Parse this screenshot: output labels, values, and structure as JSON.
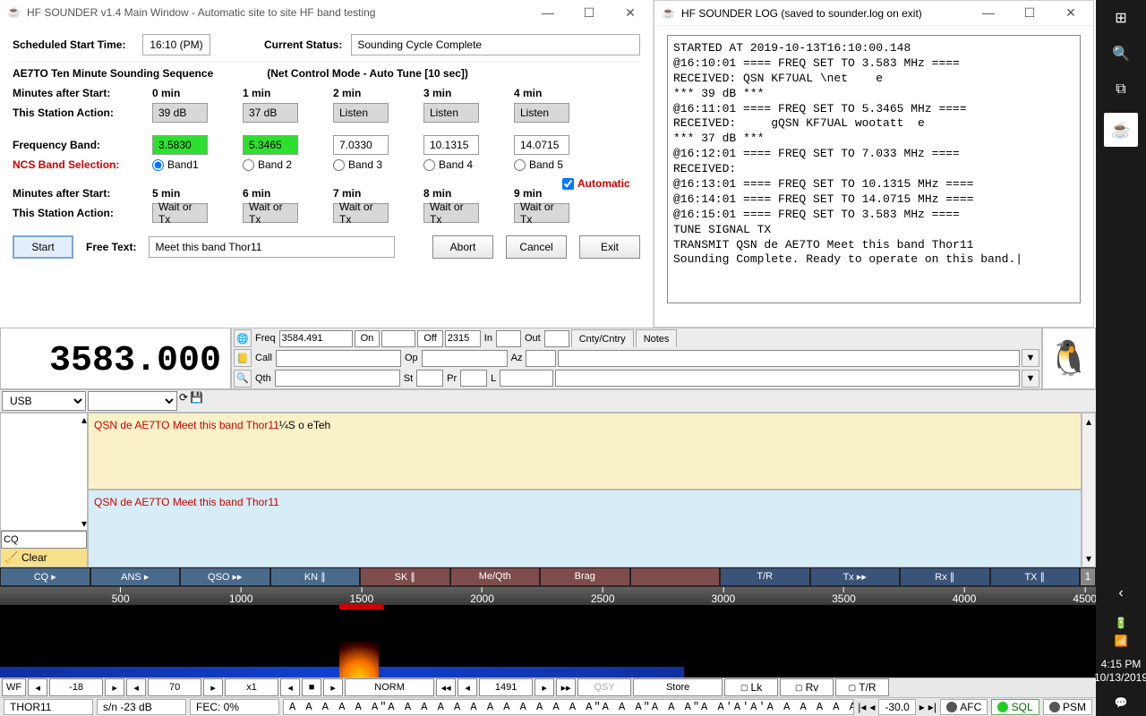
{
  "main": {
    "title": "HF SOUNDER v1.4 Main Window - Automatic site to site HF band testing",
    "scheduled_label": "Scheduled Start Time:",
    "scheduled_value": "16:10 (PM)",
    "status_label": "Current Status:",
    "status_value": "Sounding Cycle Complete",
    "sequence_title": "AE7TO  Ten Minute Sounding Sequence",
    "mode_title": "(Net Control Mode - Auto Tune [10 sec])",
    "lbl_minutes": "Minutes after Start:",
    "lbl_action": "This Station Action:",
    "lbl_freq": "Frequency Band:",
    "lbl_ncs": "NCS Band Selection:",
    "cols1": [
      {
        "min": "0 min",
        "sn": "39 dB",
        "freq": "3.5830",
        "band": "Band1",
        "green": true
      },
      {
        "min": "1 min",
        "sn": "37 dB",
        "freq": "5.3465",
        "band": "Band 2",
        "green": true
      },
      {
        "min": "2 min",
        "sn": "Listen",
        "freq": "7.0330",
        "band": "Band 3",
        "green": false
      },
      {
        "min": "3 min",
        "sn": "Listen",
        "freq": "10.1315",
        "band": "Band 4",
        "green": false
      },
      {
        "min": "4 min",
        "sn": "Listen",
        "freq": "14.0715",
        "band": "Band 5",
        "green": false
      }
    ],
    "auto_label": "Automatic",
    "cols2": [
      {
        "min": "5 min",
        "act": "Wait or Tx"
      },
      {
        "min": "6 min",
        "act": "Wait or Tx"
      },
      {
        "min": "7 min",
        "act": "Wait or Tx"
      },
      {
        "min": "8 min",
        "act": "Wait or Tx"
      },
      {
        "min": "9 min",
        "act": "Wait or Tx"
      }
    ],
    "btn_start": "Start",
    "btn_abort": "Abort",
    "btn_cancel": "Cancel",
    "btn_exit": "Exit",
    "lbl_free": "Free Text:",
    "free_value": "Meet this band Thor11"
  },
  "log": {
    "title": "HF SOUNDER LOG (saved to sounder.log on exit)",
    "text": "STARTED AT 2019-10-13T16:10:00.148\n@16:10:01 ==== FREQ SET TO 3.583 MHz ====\nRECEIVED: QSN KF7UAL \\net    e\n*** 39 dB ***\n@16:11:01 ==== FREQ SET TO 5.3465 MHz ====\nRECEIVED:     gQSN KF7UAL wootatt  e\n*** 37 dB ***\n@16:12:01 ==== FREQ SET TO 7.033 MHz ====\nRECEIVED:\n@16:13:01 ==== FREQ SET TO 10.1315 MHz ====\n@16:14:01 ==== FREQ SET TO 14.0715 MHz ====\n@16:15:01 ==== FREQ SET TO 3.583 MHz ====\nTUNE SIGNAL TX\nTRANSMIT QSN de AE7TO Meet this band Thor11\nSounding Complete. Ready to operate on this band.|"
  },
  "fldigi": {
    "big_freq": "3583.000",
    "mode_sel": "USB",
    "labels": {
      "freq": "Freq",
      "on": "On",
      "off": "Off",
      "in": "In",
      "out": "Out",
      "cnty": "Cnty/Cntry",
      "notes": "Notes",
      "call": "Call",
      "op": "Op",
      "az": "Az",
      "qth": "Qth",
      "st": "St",
      "pr": "Pr",
      "l": "L"
    },
    "freq_val": "3584.491",
    "off_val": "2315",
    "rx_red": "QSN de AE7TO Meet this band Thor11",
    "rx_black": "¼S o eTeh",
    "tx_red": "QSN de AE7TO Meet this band Thor11",
    "cq_val": "CQ",
    "clear": "Clear",
    "macros": [
      {
        "t": "CQ ▸",
        "c": "blue"
      },
      {
        "t": "ANS ▸",
        "c": "blue"
      },
      {
        "t": "QSO ▸▸",
        "c": "blue"
      },
      {
        "t": "KN ∥",
        "c": "blue"
      },
      {
        "t": "SK ∥",
        "c": "mar"
      },
      {
        "t": "Me/Qth",
        "c": "mar"
      },
      {
        "t": "Brag",
        "c": "mar"
      },
      {
        "t": "",
        "c": "mar"
      },
      {
        "t": "T/R",
        "c": "navy"
      },
      {
        "t": "Tx ▸▸",
        "c": "navy"
      },
      {
        "t": "Rx ∥",
        "c": "navy"
      },
      {
        "t": "TX ∥",
        "c": "navy"
      }
    ],
    "macro_num": "1",
    "ruler_ticks": [
      "500",
      "1000",
      "1500",
      "2000",
      "2500",
      "3000",
      "3500",
      "4000",
      "4500"
    ],
    "wf_lvl": "-18",
    "wf_rng": "70",
    "wf_zoom": "x1",
    "wf_mode": "NORM",
    "wf_cursor": "1491",
    "wf_btn": "WF",
    "wf_qsy": "QSY",
    "wf_store": "Store",
    "wf_lk": "Lk",
    "wf_rv": "Rv",
    "wf_tr": "T/R",
    "status_mode": "THOR11",
    "status_sn": "s/n -23 dB",
    "status_fec": "FEC:    0%",
    "status_aaa": "A A A A A A\"A A A A A A A A A A A A A\"A A A\"A A A\"A A'A'A'A A A A A A",
    "status_db": "-30.0",
    "status_afc": "AFC",
    "status_sql": "SQL",
    "status_psm": "PSM"
  },
  "tray": {
    "time": "4:15 PM",
    "date": "10/13/2019"
  }
}
